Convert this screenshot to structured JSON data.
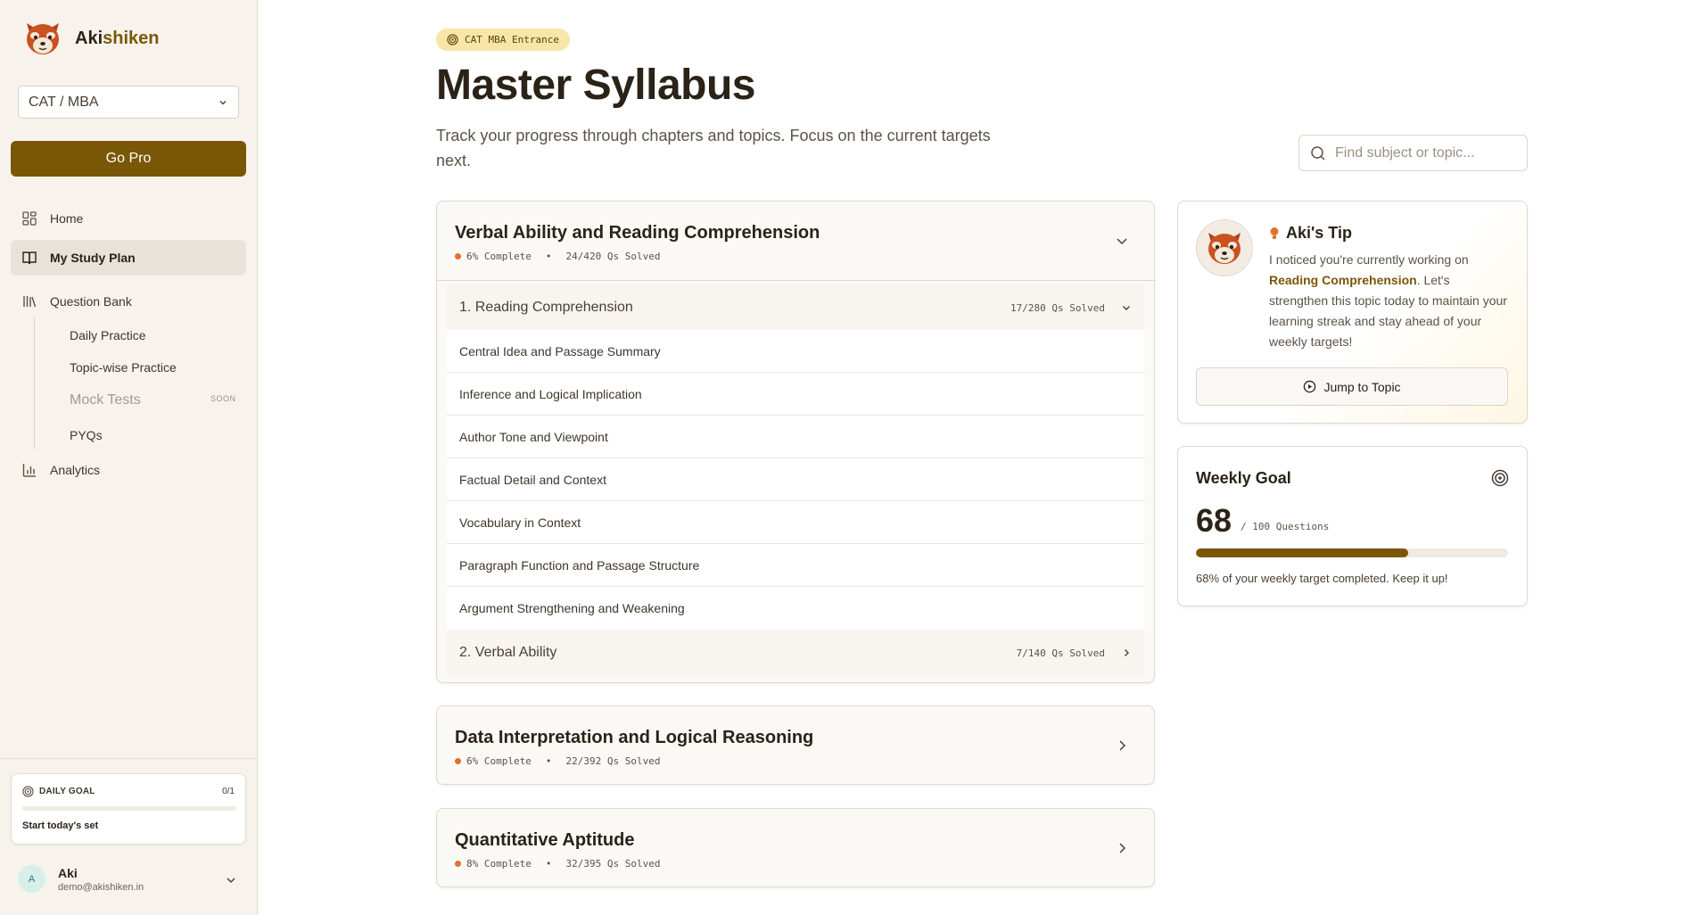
{
  "brand": {
    "name_prefix": "Aki",
    "name_suffix": "shiken"
  },
  "sidebar": {
    "exam_select": {
      "value": "CAT / MBA"
    },
    "go_pro": "Go Pro",
    "nav": {
      "home": "Home",
      "study_plan": "My Study Plan",
      "question_bank": "Question Bank",
      "daily_practice": "Daily Practice",
      "topic_practice": "Topic-wise Practice",
      "mock_tests": "Mock Tests",
      "mock_badge": "SOON",
      "pyqs": "PYQs",
      "analytics": "Analytics"
    },
    "daily_goal": {
      "label": "DAILY GOAL",
      "count": "0/1",
      "progress": 0,
      "cta": "Start today's set"
    },
    "user": {
      "initial": "A",
      "name": "Aki",
      "email": "demo@akishiken.in"
    }
  },
  "header": {
    "badge": "CAT MBA Entrance",
    "title": "Master Syllabus",
    "subtitle": "Track your progress through chapters and topics. Focus on the current targets next.",
    "search_placeholder": "Find subject or topic..."
  },
  "subjects": [
    {
      "title": "Verbal Ability and Reading Comprehension",
      "complete": "6% Complete",
      "solved": "24/420 Qs Solved",
      "expanded": true,
      "chapters": [
        {
          "name": "1. Reading Comprehension",
          "solved": "17/280 Qs Solved",
          "expanded": true,
          "topics": [
            "Central Idea and Passage Summary",
            "Inference and Logical Implication",
            "Author Tone and Viewpoint",
            "Factual Detail and Context",
            "Vocabulary in Context",
            "Paragraph Function and Passage Structure",
            "Argument Strengthening and Weakening"
          ]
        },
        {
          "name": "2. Verbal Ability",
          "solved": "7/140 Qs Solved",
          "expanded": false
        }
      ]
    },
    {
      "title": "Data Interpretation and Logical Reasoning",
      "complete": "6% Complete",
      "solved": "22/392 Qs Solved",
      "expanded": false
    },
    {
      "title": "Quantitative Aptitude",
      "complete": "8% Complete",
      "solved": "32/395 Qs Solved",
      "expanded": false
    }
  ],
  "tip": {
    "title": "Aki's Tip",
    "text_before": "I noticed you're currently working on ",
    "highlight": "Reading Comprehension",
    "text_after": ". Let's strengthen this topic today to maintain your learning streak and stay ahead of your weekly targets!",
    "button": "Jump to Topic"
  },
  "weekly_goal": {
    "title": "Weekly Goal",
    "value": "68",
    "target": "/ 100 Questions",
    "progress_fraction": 0.68,
    "message": "68% of your weekly target completed. Keep it up!"
  },
  "colors": {
    "accent": "#7a5706",
    "badge_bg": "#f8e6a6",
    "progress_dot": "#e0722a",
    "sidebar_bg": "#f7f3ec"
  },
  "icons": [
    "red-panda-logo",
    "chevron-down-icon",
    "grid-icon",
    "book-icon",
    "library-icon",
    "bar-chart-icon",
    "target-icon",
    "search-icon",
    "chevron-right-icon",
    "lightbulb-icon",
    "play-circle-icon"
  ]
}
